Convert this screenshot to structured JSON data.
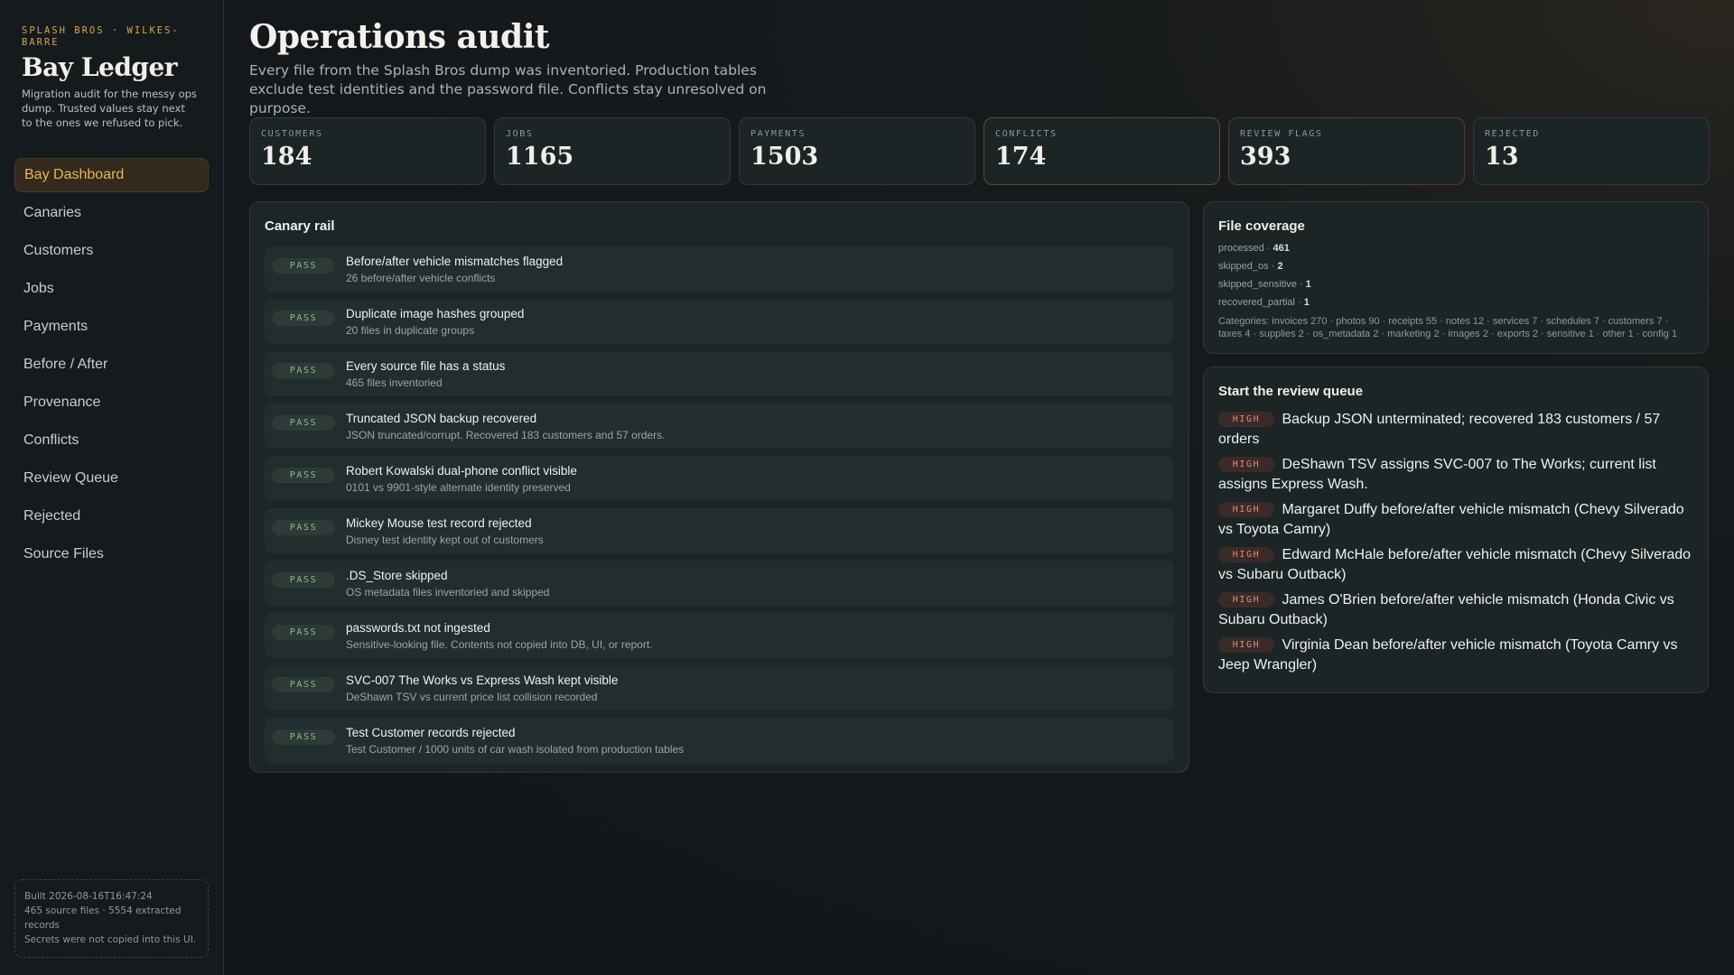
{
  "sidebar": {
    "eyebrow": "SPLASH BROS · WILKES-BARRE",
    "title": "Bay Ledger",
    "description": "Migration audit for the messy ops dump. Trusted values stay next to the ones we refused to pick.",
    "items": [
      {
        "label": "Bay Dashboard",
        "active": true
      },
      {
        "label": "Canaries"
      },
      {
        "label": "Customers"
      },
      {
        "label": "Jobs"
      },
      {
        "label": "Payments"
      },
      {
        "label": "Before / After"
      },
      {
        "label": "Provenance"
      },
      {
        "label": "Conflicts"
      },
      {
        "label": "Review Queue"
      },
      {
        "label": "Rejected"
      },
      {
        "label": "Source Files"
      }
    ],
    "build": {
      "built": "Built 2026-08-16T16:47:24",
      "counts": "465 source files · 5554 extracted records",
      "secrets": "Secrets were not copied into this UI."
    }
  },
  "header": {
    "title": "Operations audit",
    "subtitle": "Every file from the Splash Bros dump was inventoried. Production tables exclude test identities and the password file. Conflicts stay unresolved on purpose."
  },
  "stats": [
    {
      "label": "CUSTOMERS",
      "value": "184"
    },
    {
      "label": "JOBS",
      "value": "1165"
    },
    {
      "label": "PAYMENTS",
      "value": "1503"
    },
    {
      "label": "CONFLICTS",
      "value": "174"
    },
    {
      "label": "REVIEW FLAGS",
      "value": "393"
    },
    {
      "label": "REJECTED",
      "value": "13"
    }
  ],
  "canary": {
    "title": "Canary rail",
    "badge": "PASS",
    "rows": [
      {
        "title": "Before/after vehicle mismatches flagged",
        "sub": "26 before/after vehicle conflicts"
      },
      {
        "title": "Duplicate image hashes grouped",
        "sub": "20 files in duplicate groups"
      },
      {
        "title": "Every source file has a status",
        "sub": "465 files inventoried"
      },
      {
        "title": "Truncated JSON backup recovered",
        "sub": "JSON truncated/corrupt. Recovered 183 customers and 57 orders."
      },
      {
        "title": "Robert Kowalski dual-phone conflict visible",
        "sub": "0101 vs 9901-style alternate identity preserved"
      },
      {
        "title": "Mickey Mouse test record rejected",
        "sub": "Disney test identity kept out of customers"
      },
      {
        "title": ".DS_Store skipped",
        "sub": "OS metadata files inventoried and skipped"
      },
      {
        "title": "passwords.txt not ingested",
        "sub": "Sensitive-looking file. Contents not copied into DB, UI, or report."
      },
      {
        "title": "SVC-007 The Works vs Express Wash kept visible",
        "sub": "DeShawn TSV vs current price list collision recorded"
      },
      {
        "title": "Test Customer records rejected",
        "sub": "Test Customer / 1000 units of car wash isolated from production tables"
      }
    ]
  },
  "coverage": {
    "title": "File coverage",
    "lines": [
      {
        "key": "processed",
        "value": "461"
      },
      {
        "key": "skipped_os",
        "value": "2"
      },
      {
        "key": "skipped_sensitive",
        "value": "1"
      },
      {
        "key": "recovered_partial",
        "value": "1"
      }
    ],
    "separator": " · ",
    "categories": "Categories: invoices 270 · photos 90 · receipts 55 · notes 12 · services 7 · schedules 7 · customers 7 · taxes 4 · supplies 2 · os_metadata 2 · marketing 2 · images 2 · exports 2 · sensitive 1 · other 1 · config 1"
  },
  "queue": {
    "title": "Start the review queue",
    "badge": "HIGH",
    "items": [
      "Backup JSON unterminated; recovered 183 customers / 57 orders",
      "DeShawn TSV assigns SVC-007 to The Works; current list assigns Express Wash.",
      "Margaret Duffy before/after vehicle mismatch (Chevy Silverado vs Toyota Camry)",
      "Edward McHale before/after vehicle mismatch (Chevy Silverado vs Subaru Outback)",
      "James O'Brien before/after vehicle mismatch (Honda Civic vs Subaru Outback)",
      "Virginia Dean before/after vehicle mismatch (Toyota Camry vs Jeep Wrangler)"
    ]
  },
  "colors": {
    "accent": "#e9b654",
    "pass": "#8fb898",
    "high": "#e08a78"
  }
}
